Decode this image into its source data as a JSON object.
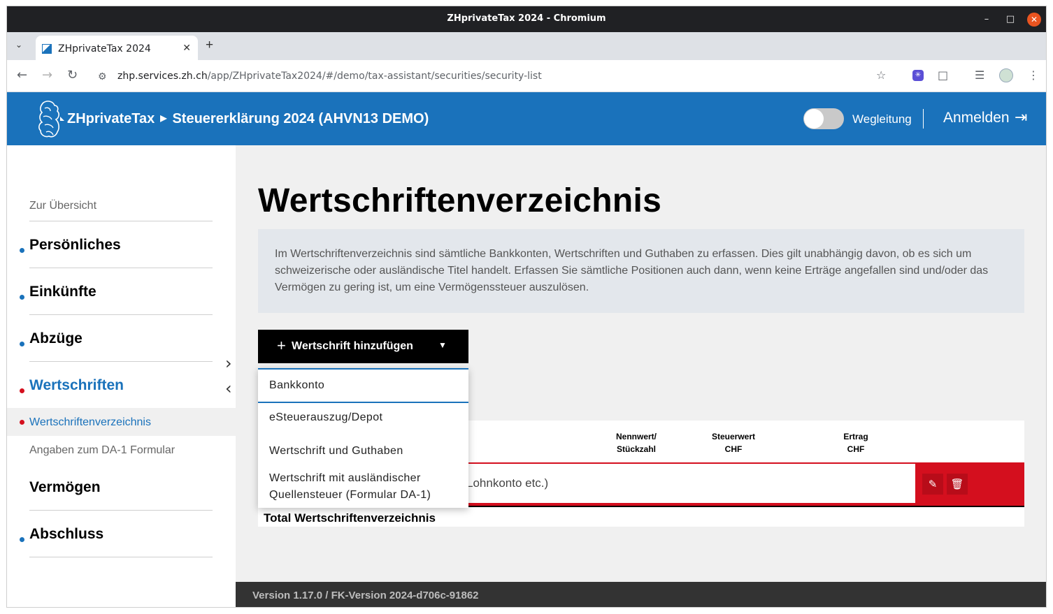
{
  "browser": {
    "window_title": "ZHprivateTax 2024 - Chromium",
    "tab_title": "ZHprivateTax 2024",
    "url_host": "zhp.services.zh.ch",
    "url_path": "/app/ZHprivateTax2024/#/demo/tax-assistant/securities/security-list"
  },
  "header": {
    "brand": "ZHprivateTax",
    "subtitle": "Steuererklärung 2024 (AHVN13 DEMO)",
    "wegleitung": "Wegleitung",
    "login": "Anmelden",
    "brand_color": "#1a72bb"
  },
  "sidebar": {
    "overview": "Zur Übersicht",
    "items": [
      {
        "label": "Persönliches"
      },
      {
        "label": "Einkünfte"
      },
      {
        "label": "Abzüge"
      },
      {
        "label": "Wertschriften"
      },
      {
        "label": "Vermögen"
      },
      {
        "label": "Abschluss"
      }
    ],
    "subitems": [
      {
        "label": "Wertschriftenverzeichnis"
      },
      {
        "label": "Angaben zum DA-1 Formular"
      }
    ]
  },
  "main": {
    "title": "Wertschriftenverzeichnis",
    "info": "Im Wertschriftenverzeichnis sind sämtliche Bankkonten, Wertschriften und Guthaben zu erfassen. Dies gilt unabhängig davon, ob es sich um schweizerische oder ausländische Titel handelt. Erfassen Sie sämtliche Positionen auch dann, wenn keine Erträge angefallen sind und/oder das Vermögen zu gering ist, um eine Vermögenssteuer auszulösen.",
    "add_button": "Wertschrift hinzufügen",
    "dropdown": [
      "Bankkonto",
      "eSteuerauszug/Depot",
      "Wertschrift und Guthaben",
      "Wertschrift mit ausländischer Quellensteuer (Formular DA-1)"
    ],
    "table": {
      "col_nennwert_1": "Nennwert/",
      "col_nennwert_2": "Stückzahl",
      "col_steuerwert_1": "Steuerwert",
      "col_steuerwert_2": "CHF",
      "col_ertrag_1": "Ertrag",
      "col_ertrag_2": "CHF",
      "row_text": "Lohnkonto etc.)",
      "total": "Total Wertschriftenverzeichnis"
    }
  },
  "footer": {
    "version": "Version 1.17.0 / FK-Version 2024-d706c-91862"
  }
}
